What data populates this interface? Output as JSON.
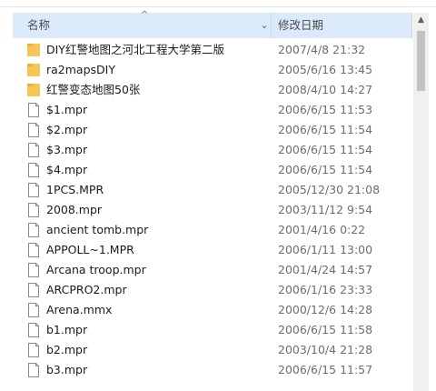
{
  "header": {
    "name_label": "名称",
    "date_label": "修改日期",
    "sort_glyph": "^",
    "dropdown_glyph": "⌄"
  },
  "scrollbar": {
    "up_glyph": "▲"
  },
  "icons": {
    "folder": "folder-icon",
    "file": "file-icon"
  },
  "colors": {
    "header_bg": "#dbeaf9",
    "folder": "#f6c655",
    "date_text": "#6d6d6d"
  },
  "files": [
    {
      "name": "DIY红警地图之河北工程大学第二版",
      "date": "2007/4/8 21:32",
      "type": "folder"
    },
    {
      "name": "ra2mapsDIY",
      "date": "2005/6/16 13:45",
      "type": "folder"
    },
    {
      "name": "红警变态地图50张",
      "date": "2008/4/10 14:27",
      "type": "folder"
    },
    {
      "name": "$1.mpr",
      "date": "2006/6/15 11:53",
      "type": "file"
    },
    {
      "name": "$2.mpr",
      "date": "2006/6/15 11:54",
      "type": "file"
    },
    {
      "name": "$3.mpr",
      "date": "2006/6/15 11:54",
      "type": "file"
    },
    {
      "name": "$4.mpr",
      "date": "2006/6/15 11:54",
      "type": "file"
    },
    {
      "name": "1PCS.MPR",
      "date": "2005/12/30 21:08",
      "type": "file"
    },
    {
      "name": "2008.mpr",
      "date": "2003/11/12 9:54",
      "type": "file"
    },
    {
      "name": "ancient tomb.mpr",
      "date": "2001/4/16 0:22",
      "type": "file"
    },
    {
      "name": "APPOLL~1.MPR",
      "date": "2006/1/11 13:00",
      "type": "file"
    },
    {
      "name": "Arcana troop.mpr",
      "date": "2001/4/24 14:57",
      "type": "file"
    },
    {
      "name": "ARCPRO2.mpr",
      "date": "2006/1/16 23:33",
      "type": "file"
    },
    {
      "name": "Arena.mmx",
      "date": "2000/12/6 14:28",
      "type": "file"
    },
    {
      "name": "b1.mpr",
      "date": "2006/6/15 11:58",
      "type": "file"
    },
    {
      "name": "b2.mpr",
      "date": "2003/10/4 21:28",
      "type": "file"
    },
    {
      "name": "b3.mpr",
      "date": "2006/6/15 11:57",
      "type": "file"
    }
  ]
}
